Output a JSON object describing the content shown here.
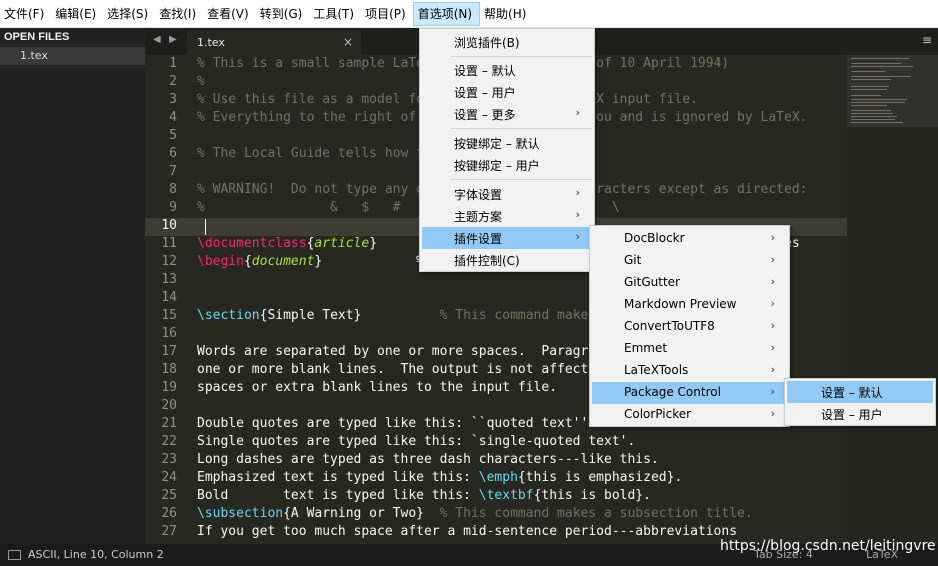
{
  "menubar": [
    "文件(F)",
    "编辑(E)",
    "选择(S)",
    "查找(I)",
    "查看(V)",
    "转到(G)",
    "工具(T)",
    "项目(P)",
    "首选项(N)",
    "帮助(H)"
  ],
  "sidebar": {
    "title": "OPEN FILES",
    "file": "1.tex"
  },
  "tabbar": {
    "tab": "1.tex",
    "close": "×",
    "nav_left": "◀",
    "nav_right": "▶",
    "menu": "≡"
  },
  "editor": {
    "line_numbers": [
      "1",
      "2",
      "3",
      "4",
      "5",
      "6",
      "7",
      "8",
      "9",
      "10",
      "11",
      "12",
      "13",
      "14",
      "15",
      "16",
      "17",
      "18",
      "19",
      "20",
      "21",
      "22",
      "23",
      "24",
      "25",
      "26",
      "27"
    ]
  },
  "menu_preferences": {
    "items": [
      {
        "label": "浏览插件(B)",
        "submenu": false
      },
      {
        "label": "设置 – 默认",
        "submenu": false
      },
      {
        "label": "设置 – 用户",
        "submenu": false
      },
      {
        "label": "设置 – 更多",
        "submenu": true
      },
      {
        "label": "按键绑定 – 默认",
        "submenu": false
      },
      {
        "label": "按键绑定 – 用户",
        "submenu": false
      },
      {
        "label": "字体设置",
        "submenu": true
      },
      {
        "label": "主题方案",
        "submenu": true
      },
      {
        "label": "插件设置",
        "submenu": true
      },
      {
        "label": "插件控制(C)",
        "submenu": false
      }
    ]
  },
  "menu_plugins": {
    "items": [
      "DocBlockr",
      "Git",
      "GitGutter",
      "Markdown Preview",
      "ConvertToUTF8",
      "Emmet",
      "LaTeXTools",
      "Package Control",
      "ColorPicker"
    ]
  },
  "menu_package_control": {
    "items": [
      "设置 – 默认",
      "设置 – 用户"
    ]
  },
  "statusbar": {
    "position": "ASCII, Line 10, Column 2",
    "tab_size": "Tab Size: 4",
    "syntax": "LaTeX"
  },
  "watermark": "https://blog.csdn.net/leitingvre",
  "colors": {
    "editor_bg": "#272822",
    "comment": "#75715e",
    "keyword": "#66d9ef",
    "highlight": "#91c9f7"
  }
}
